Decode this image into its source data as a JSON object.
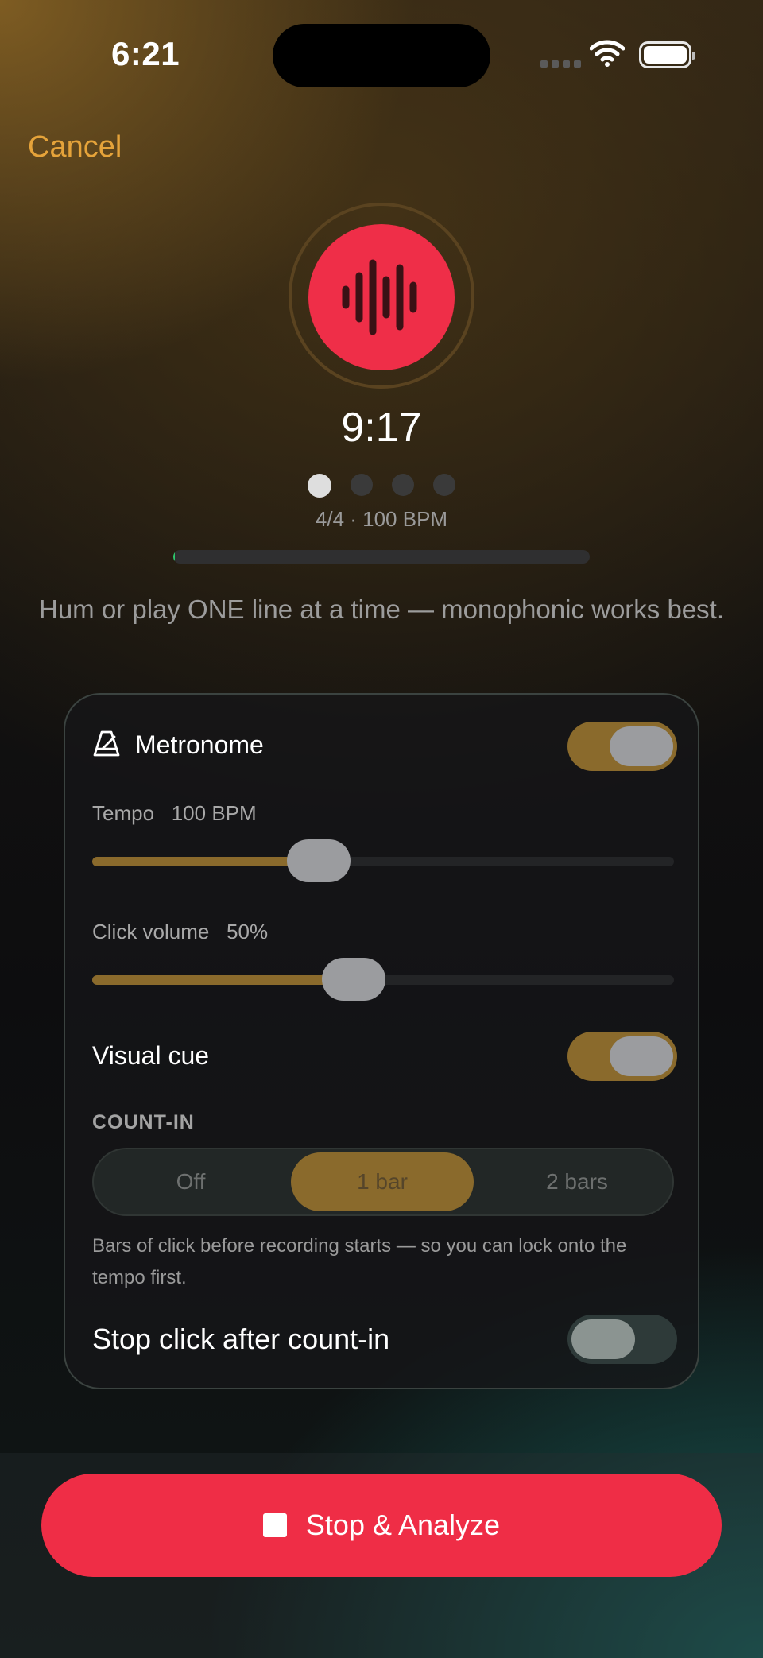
{
  "status_bar": {
    "time": "6:21",
    "signal_icon": "cellular-signal-icon",
    "wifi_icon": "wifi-icon",
    "battery_icon": "battery-icon"
  },
  "header": {
    "cancel_label": "Cancel"
  },
  "recorder": {
    "mic_icon": "waveform-icon",
    "accent_color": "#ef2e48",
    "elapsed": "9:17",
    "beats_total": 4,
    "beat_active": 1,
    "meter_label": "4/4 · 100 BPM",
    "input_level": 0.004,
    "hint": "Hum or play ONE line at a time — monophonic works best."
  },
  "metronome": {
    "icon": "metronome-icon",
    "title": "Metronome",
    "enabled": true,
    "tempo": {
      "label": "Tempo",
      "value": "100 BPM",
      "fraction": 0.39
    },
    "click_volume": {
      "label": "Click volume",
      "value": "50%",
      "fraction": 0.45
    },
    "visual_cue": {
      "label": "Visual cue",
      "enabled": true
    },
    "count_in": {
      "heading": "COUNT-IN",
      "options": [
        "Off",
        "1 bar",
        "2 bars"
      ],
      "selected": "1 bar",
      "note": "Bars of click before recording starts — so you can lock onto the tempo first."
    },
    "stop_click": {
      "label": "Stop click after count-in",
      "enabled": false
    },
    "toggle_on_color": "#8a6a2c"
  },
  "footer": {
    "stop_label": "Stop & Analyze",
    "stop_icon": "stop-square-icon",
    "button_color": "#ef2d46"
  }
}
